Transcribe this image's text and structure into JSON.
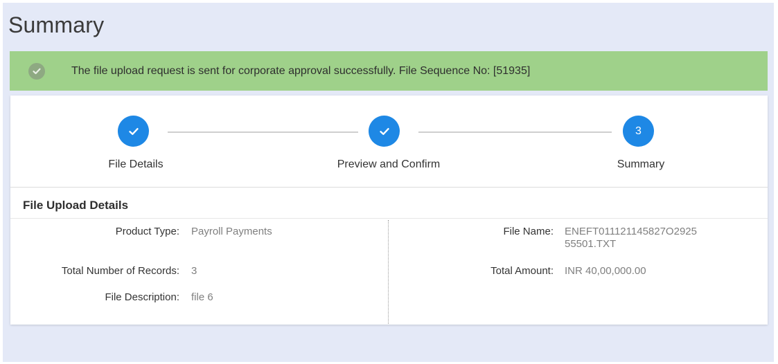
{
  "page": {
    "title": "Summary"
  },
  "alert": {
    "message": "The file upload request is sent for corporate approval successfully. File Sequence No: [51935]",
    "icon": "check-circle-icon",
    "color": "#9fd18a"
  },
  "stepper": {
    "accent": "#1e88e5",
    "steps": [
      {
        "label": "File Details",
        "status": "completed",
        "marker": "✓"
      },
      {
        "label": "Preview and Confirm",
        "status": "completed",
        "marker": "✓"
      },
      {
        "label": "Summary",
        "status": "current",
        "marker": "3"
      }
    ]
  },
  "details": {
    "title": "File Upload Details",
    "left": [
      {
        "label": "Product Type:",
        "value": "Payroll Payments"
      },
      {
        "label": "Total Number of Records:",
        "value": "3"
      },
      {
        "label": "File Description:",
        "value": "file 6"
      }
    ],
    "right": [
      {
        "label": "File Name:",
        "value_line1": "ENEFT011121145827O2925",
        "value_line2": "55501.TXT"
      },
      {
        "label": "Total Amount:",
        "value": "INR 40,00,000.00"
      }
    ]
  }
}
